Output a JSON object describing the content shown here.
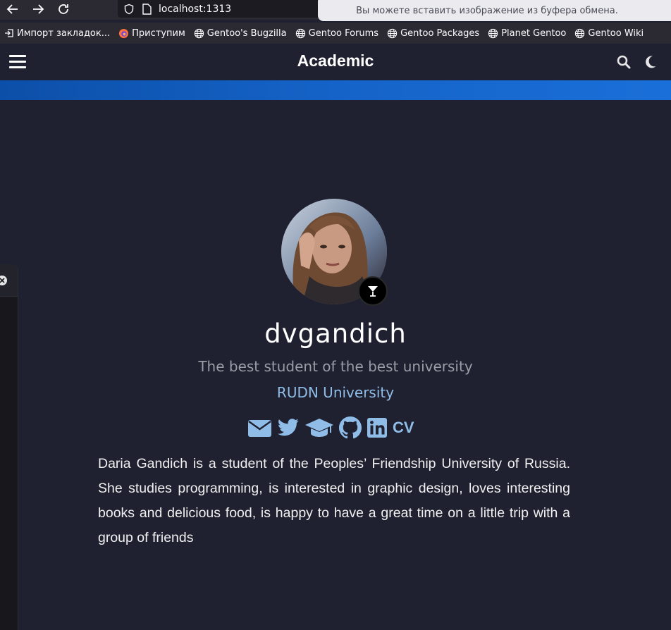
{
  "browser": {
    "url": "localhost:1313",
    "clipboard_notice": "Вы можете вставить изображение из буфера обмена.",
    "bookmarks": [
      {
        "label": "Импорт закладок...",
        "icon": "import-icon"
      },
      {
        "label": "Приступим",
        "icon": "firefox-icon"
      },
      {
        "label": "Gentoo's Bugzilla",
        "icon": "globe-icon"
      },
      {
        "label": "Gentoo Forums",
        "icon": "globe-icon"
      },
      {
        "label": "Gentoo Packages",
        "icon": "globe-icon"
      },
      {
        "label": "Planet Gentoo",
        "icon": "globe-icon"
      },
      {
        "label": "Gentoo Wiki",
        "icon": "globe-icon"
      }
    ]
  },
  "site": {
    "title": "Academic",
    "nav_icons": [
      "menu-icon",
      "search-icon",
      "moon-icon"
    ]
  },
  "profile": {
    "name": "dvgandich",
    "role": "The best student of the best university",
    "organization": "RUDN University",
    "badge_icon": "cocktail-icon",
    "social": [
      "envelope-icon",
      "twitter-icon",
      "graduation-cap-icon",
      "github-icon",
      "linkedin-icon"
    ],
    "cv_label": "CV",
    "bio": "Daria Gandich is a student of the Peoples’ Friendship University of Russia. She studies programming, is interested in graphic design, loves interesting books and delicious food, is happy to have a great time on a little trip with a group of friends"
  },
  "colors": {
    "background": "#1f2130",
    "accent": "#8fbde7",
    "hero_band": "#1563c8"
  }
}
